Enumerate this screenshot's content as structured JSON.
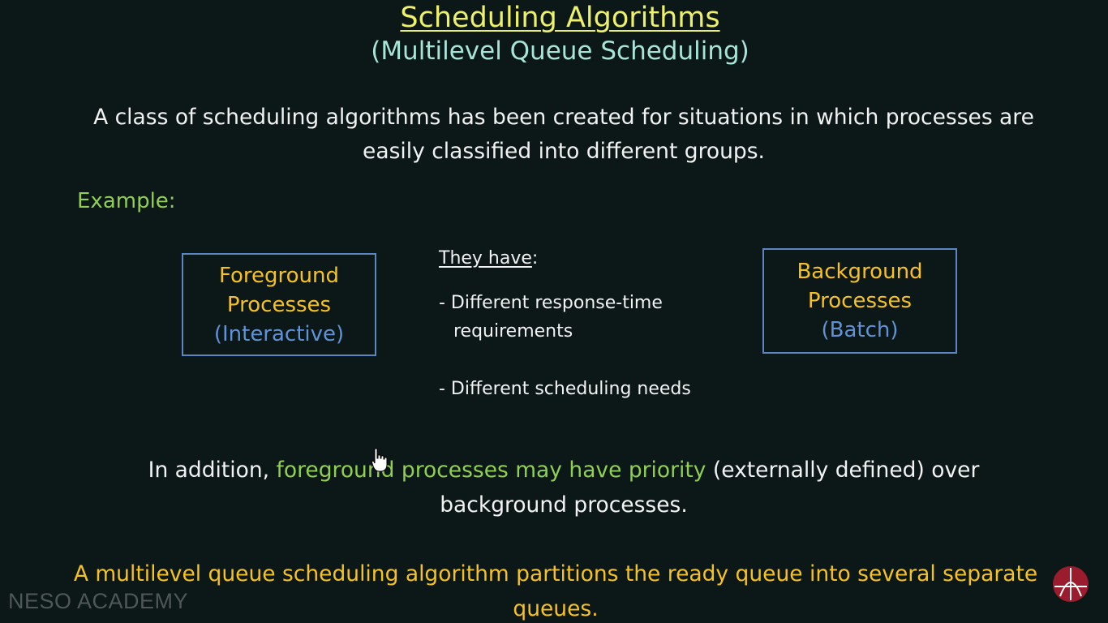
{
  "slide": {
    "title": "Scheduling Algorithms",
    "subtitle": "(Multilevel Queue Scheduling)",
    "intro_line1": "A class of scheduling algorithms has been created for situations in which processes are",
    "intro_line2": "easily classified into different groups.",
    "example_label": "Example:",
    "foreground_box": {
      "line1": "Foreground",
      "line2": "Processes",
      "line3": "(Interactive)"
    },
    "background_box": {
      "line1": "Background",
      "line2": "Processes",
      "line3": "(Batch)"
    },
    "they_have": {
      "heading": "They have",
      "colon": ":",
      "point1_line1": "- Different response-time",
      "point1_line2": "requirements",
      "point2": "- Different scheduling needs"
    },
    "addition": {
      "prefix": "In addition, ",
      "highlight": "foreground processes may have priority",
      "suffix": " (externally defined) over",
      "line2": "background processes."
    },
    "final_statement": {
      "line1": "A multilevel queue scheduling algorithm partitions the ready queue into several separate",
      "line2": "queues."
    }
  },
  "watermark": "NESO ACADEMY",
  "colors": {
    "background": "#0c1717",
    "title": "#ecf06a",
    "subtitle": "#a8e5d9",
    "green": "#8fcf52",
    "orange": "#f6c21f",
    "blue": "#5f93d6",
    "box_border": "#5b86c4",
    "logo": "#9b1c2c"
  },
  "icons": {
    "logo": "neso-academy-logo-icon",
    "cursor": "hand-pointer-cursor-icon"
  }
}
